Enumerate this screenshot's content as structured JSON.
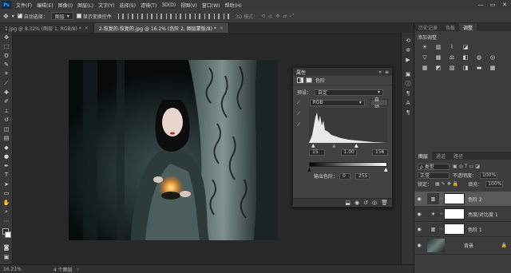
{
  "app": {
    "logo": "Ps"
  },
  "menu": [
    "文件(F)",
    "编辑(E)",
    "图像(I)",
    "图层(L)",
    "文字(Y)",
    "选择(S)",
    "滤镜(T)",
    "3D(D)",
    "视图(V)",
    "窗口(W)",
    "帮助(H)"
  ],
  "window_controls": {
    "minimize": "—",
    "maximize": "▭",
    "close": "✕"
  },
  "options_bar": {
    "auto_select_label": "自动选择：",
    "auto_select_value": "图层",
    "show_transform_label": "显示变换控件",
    "mode_3d_label": "3D 模式："
  },
  "tabs": [
    {
      "label": "1.jpg @ 8.32% (图层 1, RGB/8) *",
      "close": "×"
    },
    {
      "label": "2-恢复的-恢复的.jpg @ 16.2% (色阶 2, 图层蒙版/8) *",
      "close": "×"
    }
  ],
  "status": {
    "zoom": "16.21%",
    "doc": "4 个图层"
  },
  "properties": {
    "title": "属性",
    "collapse": "«",
    "menu": "≡",
    "type_label": "色阶",
    "preset_label": "预设：",
    "preset_value": "自定",
    "channel_value": "RGB",
    "auto_button": "自动",
    "input_black": "15",
    "input_gamma": "1.00",
    "input_white": "156",
    "output_label": "输出色阶：",
    "output_black": "0",
    "output_white": "255"
  },
  "right_panel": {
    "top_tabs": [
      "历史记录",
      "色板",
      "调整"
    ],
    "adjust_title": "添加调整",
    "layer_tabs": [
      "图层",
      "通道",
      "路径"
    ],
    "filter_value": "ρ 类型",
    "blend_mode": "正常",
    "opacity_label": "不透明度：",
    "opacity_value": "100%",
    "lock_label": "锁定：",
    "fill_label": "填充：",
    "fill_value": "100%",
    "layers": [
      {
        "name": "色阶 2",
        "thumb_icon": "levels-icon",
        "selected": true
      },
      {
        "name": "亮度/对比度 1",
        "thumb_icon": "brightness-icon",
        "selected": false
      },
      {
        "name": "色阶 1",
        "thumb_icon": "levels-icon",
        "selected": false
      },
      {
        "name": "背景",
        "thumb_icon": "photo-thumb",
        "selected": false
      }
    ]
  },
  "colors": {
    "accent_blue": "#31a8ff",
    "panel_bg": "#3c3c3c",
    "canvas_bg": "#282828"
  }
}
